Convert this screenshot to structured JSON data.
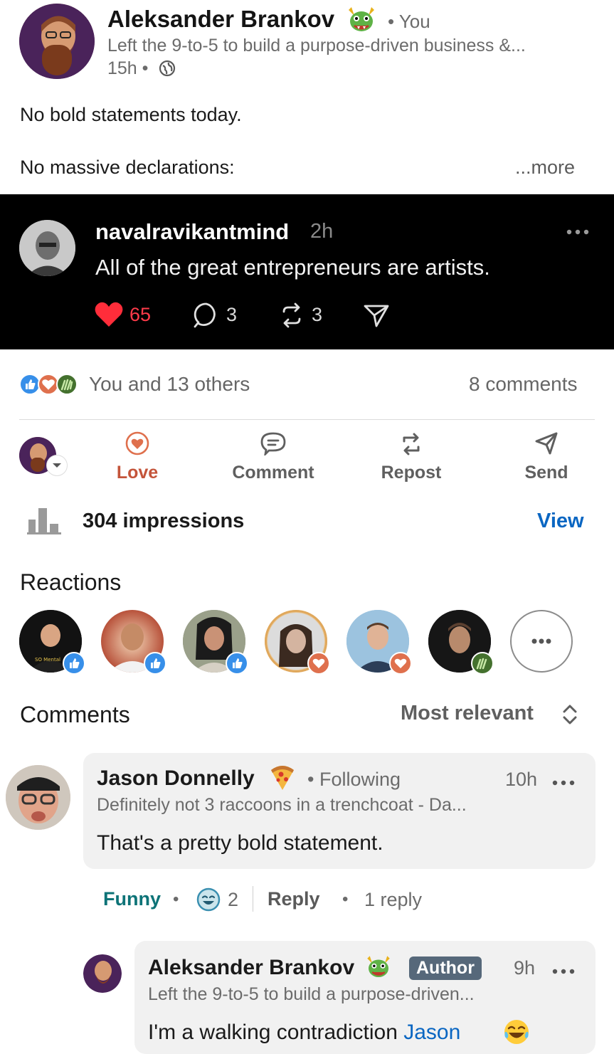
{
  "post": {
    "author_name": "Aleksander Brankov",
    "relation": "• You",
    "headline": "Left the 9-to-5 to build a purpose-driven business &...",
    "time": "15h •",
    "line1": "No bold statements today.",
    "line2": "No massive declarations:",
    "more": "...more"
  },
  "embedded": {
    "username": "navalravikantmind",
    "time": "2h",
    "text": "All of the great entrepreneurs are artists.",
    "likes": "65",
    "comments": "3",
    "reposts": "3"
  },
  "social": {
    "reactions_summary": "You and 13 others",
    "comments_count": "8 comments"
  },
  "actions": {
    "love": "Love",
    "comment": "Comment",
    "repost": "Repost",
    "send": "Send"
  },
  "analytics": {
    "impressions": "304 impressions",
    "view": "View"
  },
  "reactions": {
    "title": "Reactions"
  },
  "comments_section": {
    "title": "Comments",
    "sort": "Most relevant"
  },
  "comment1": {
    "name": "Jason Donnelly",
    "relation": "• Following",
    "time": "10h",
    "headline": "Definitely not 3 raccoons in a trenchcoat - Da...",
    "text": "That's a pretty bold statement.",
    "reaction_label": "Funny",
    "reaction_count": "2",
    "reply_label": "Reply",
    "replies": "1 reply"
  },
  "reply1": {
    "name": "Aleksander Brankov",
    "author_tag": "Author",
    "time": "9h",
    "headline": "Left the 9-to-5 to build a purpose-driven...",
    "text_prefix": "I'm a walking contradiction ",
    "mention": "Jason"
  },
  "colors": {
    "love_red": "#c4543a",
    "link_blue": "#0a66c2",
    "funny_teal": "#0d7377",
    "author_tag": "#56687a"
  }
}
